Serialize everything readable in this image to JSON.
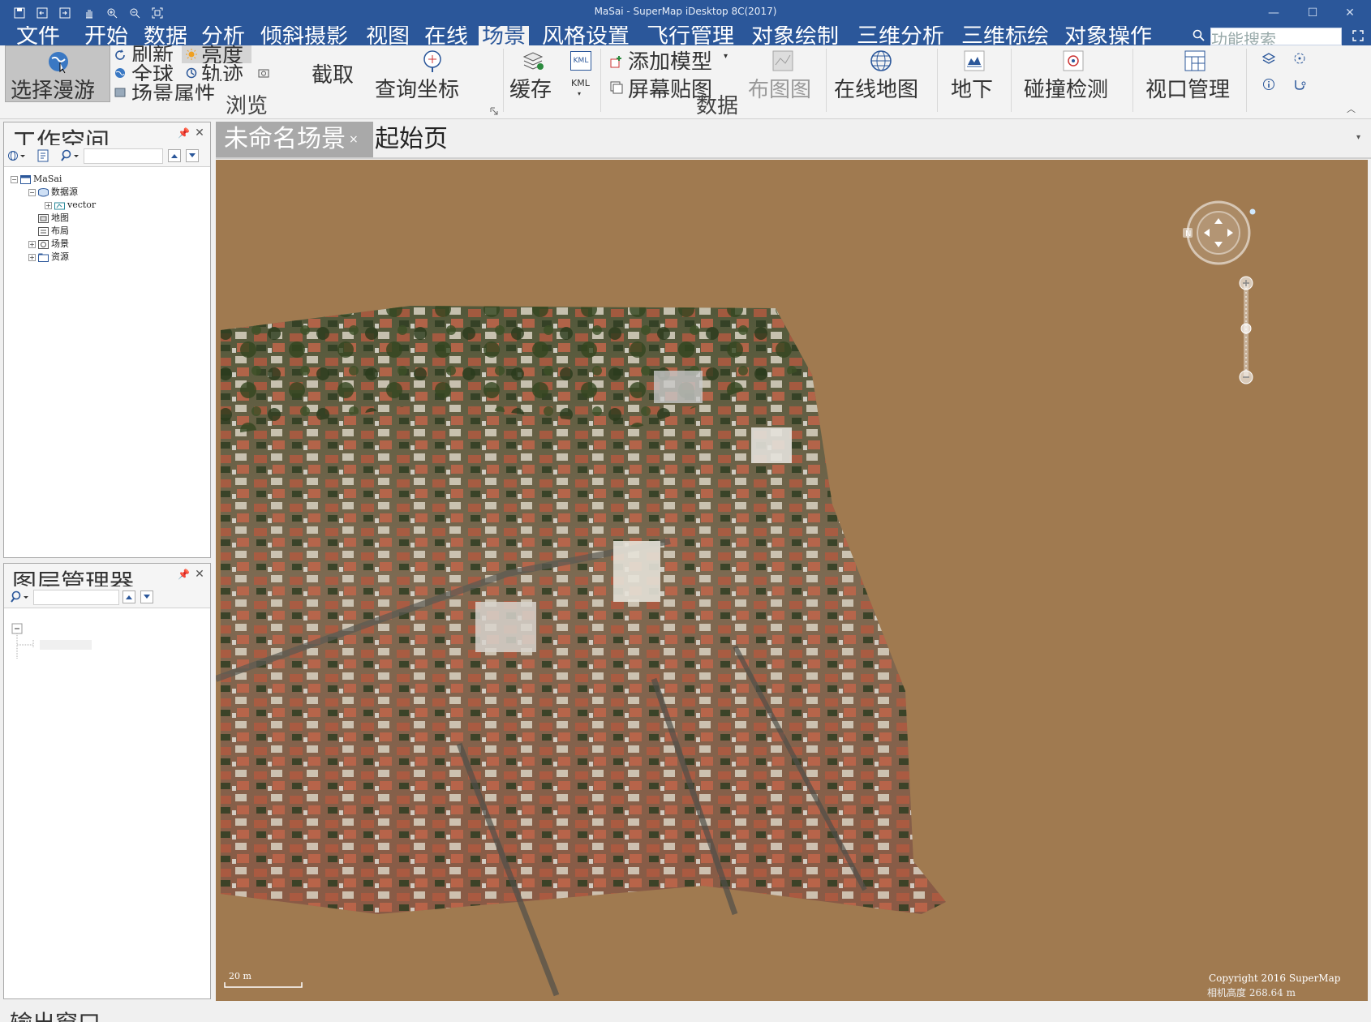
{
  "window": {
    "title": "MaSai - SuperMap iDesktop 8C(2017)",
    "quick_access_icons": [
      "save-icon",
      "undo-icon",
      "redo-icon",
      "hand-icon",
      "zoom-in-icon",
      "zoom-out-icon",
      "full-extent-icon"
    ],
    "controls": {
      "minimize": "—",
      "maximize": "☐",
      "close": "✕"
    }
  },
  "menu": {
    "tabs": [
      "文件",
      "开始",
      "数据",
      "分析",
      "倾斜摄影",
      "视图",
      "在线",
      "场景",
      "风格设置",
      "飞行管理",
      "对象绘制",
      "三维分析",
      "三维标绘",
      "对象操作"
    ],
    "active": "场景",
    "search_placeholder": "功能搜索"
  },
  "ribbon": {
    "browse": {
      "group_title": "浏览",
      "select_roam": "选择漫游",
      "refresh": "刷新",
      "sun": "亮度",
      "globe": "全球",
      "track": "轨迹",
      "scene_props": "场景属性",
      "crop": "截取",
      "query_coords": "查询坐标"
    },
    "data": {
      "group_title": "数据",
      "cache": "缓存",
      "kml": "KML",
      "add_model": "添加模型",
      "screen_layer": "屏幕贴图",
      "layout_map": "布图图",
      "online_map": "在线地图",
      "terrain": "地下",
      "connect_detect": "碰撞检测",
      "window_manage": "视口管理"
    }
  },
  "workspace_panel": {
    "title": "工作空间",
    "tree": [
      {
        "label": "MaSai",
        "level": 0,
        "expander": "−",
        "icon": "workspace-icon"
      },
      {
        "label": "数据源",
        "level": 1,
        "expander": "−",
        "icon": "datasource-icon"
      },
      {
        "label": "vector",
        "level": 2,
        "expander": "+",
        "icon": "dataset-icon"
      },
      {
        "label": "地图",
        "level": 1,
        "expander": "",
        "icon": "map-icon"
      },
      {
        "label": "布局",
        "level": 1,
        "expander": "",
        "icon": "layout-icon"
      },
      {
        "label": "场景",
        "level": 1,
        "expander": "+",
        "icon": "scene-icon"
      },
      {
        "label": "资源",
        "level": 1,
        "expander": "+",
        "icon": "resource-icon"
      }
    ]
  },
  "layer_panel": {
    "title": "图层管理器"
  },
  "document_tabs": [
    {
      "label": "未命名场景",
      "active": true,
      "closable": true
    },
    {
      "label": "起始页",
      "active": false,
      "closable": false
    }
  ],
  "scene": {
    "scale_label": "20 m",
    "copyright": "Copyright 2016 SuperMap",
    "camera_height": "相机高度 268.64 m"
  },
  "output_panel": {
    "title": "输出窗口"
  },
  "colors": {
    "accent": "#2b579a",
    "ribbon_bg": "#f3f3f3",
    "scene_ground": "#a07a50",
    "active_doc_tab": "#a9a9a9"
  }
}
